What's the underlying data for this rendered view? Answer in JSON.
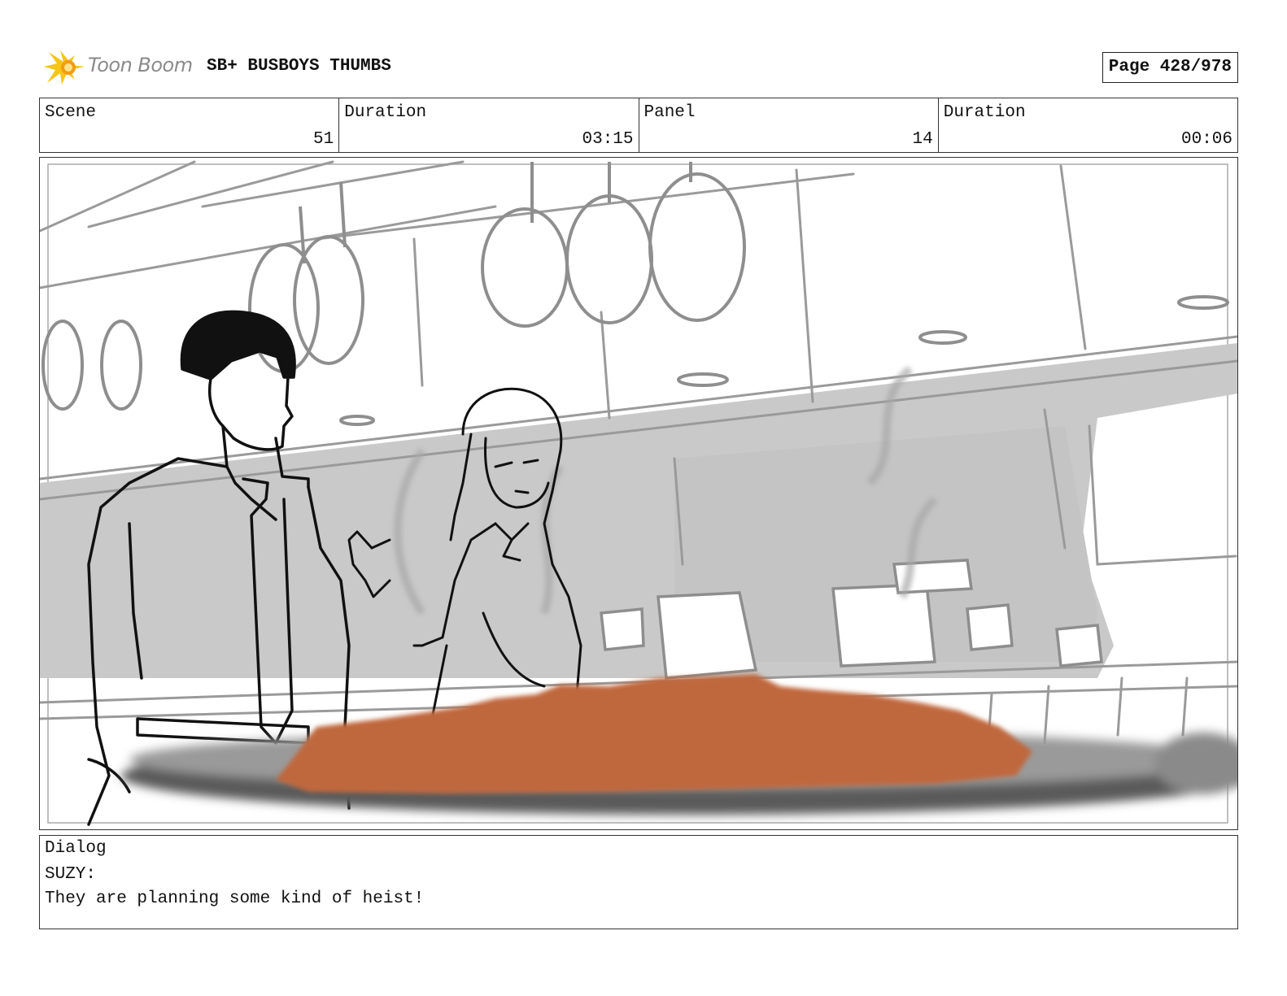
{
  "header": {
    "logo_text": "Toon Boom",
    "project_title": "SB+ BUSBOYS THUMBS",
    "page_label": "Page 428/978"
  },
  "info": {
    "scene_label": "Scene",
    "scene_value": "51",
    "scene_duration_label": "Duration",
    "scene_duration_value": "03:15",
    "panel_label": "Panel",
    "panel_value": "14",
    "panel_duration_label": "Duration",
    "panel_duration_value": "00:06"
  },
  "dialog": {
    "label": "Dialog",
    "speaker": "SUZY:",
    "line": "They are planning some kind of heist!"
  },
  "colors": {
    "sauce": "#c0683e",
    "sketch_gray": "#9a9a9a",
    "wall_gray": "#c8c8c8",
    "logo_yellow": "#f5c518"
  }
}
